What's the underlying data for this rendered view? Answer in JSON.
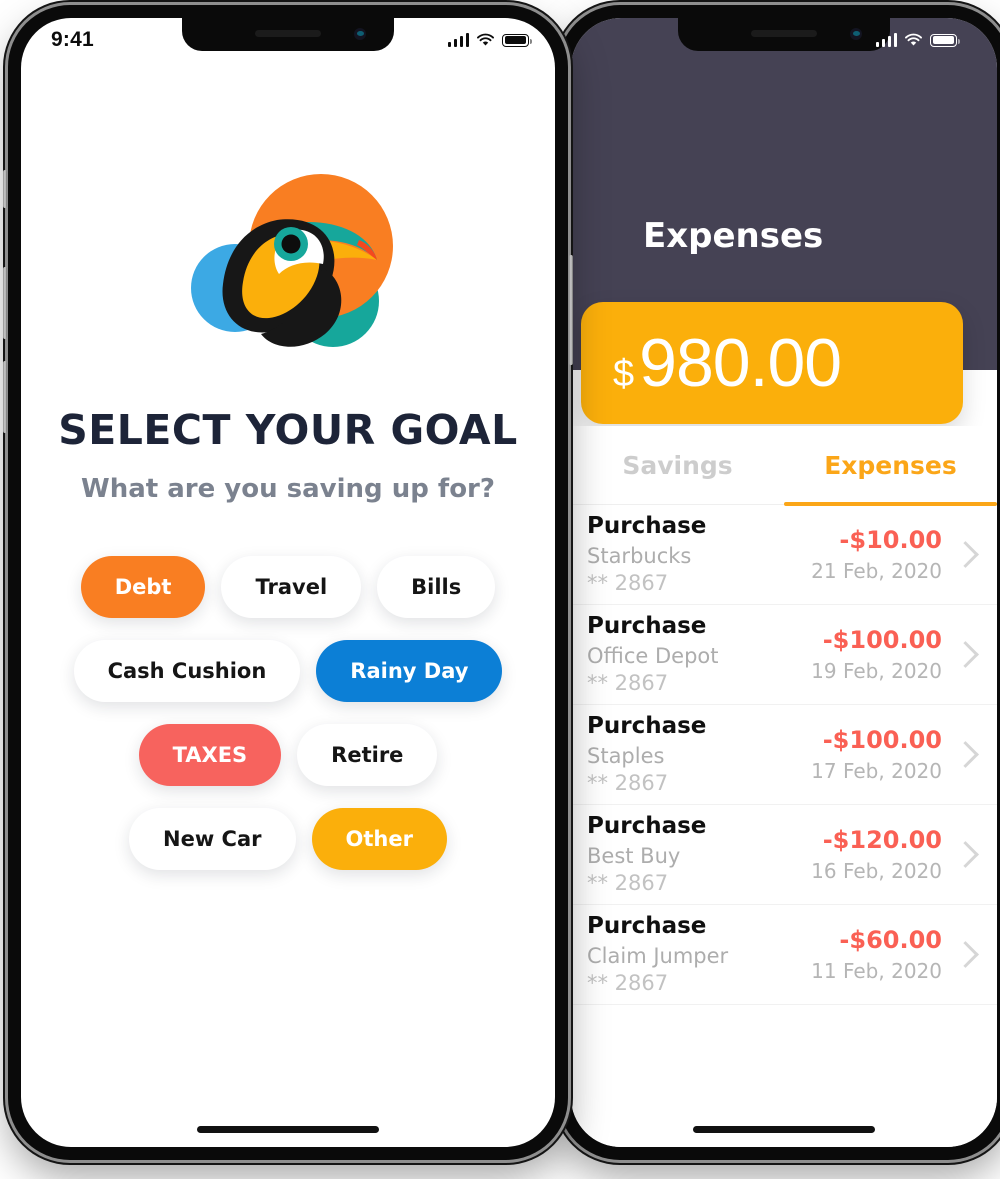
{
  "colors": {
    "orange": "#F97E22",
    "blue": "#0C7FD6",
    "red": "#F7635E",
    "amber": "#FBAF0B",
    "teal": "#16A79B",
    "sky": "#3CA9E4",
    "navy": "#1D2438",
    "slate": "#454254",
    "expense_red": "#FA6054",
    "tab_active": "#FBA618"
  },
  "phone1": {
    "status": {
      "time": "9:41",
      "cellular_icon": "signal-bars-icon",
      "wifi_icon": "wifi-icon",
      "battery_icon": "battery-icon"
    },
    "logo": {
      "name": "toucan-logo"
    },
    "title": "SELECT YOUR GOAL",
    "subtitle": "What are you saving up for?",
    "chip_rows": [
      [
        {
          "label": "Debt",
          "selected": true,
          "color": "#F97E22"
        },
        {
          "label": "Travel",
          "selected": false,
          "color": "#FFFFFF"
        },
        {
          "label": "Bills",
          "selected": false,
          "color": "#FFFFFF"
        }
      ],
      [
        {
          "label": "Cash Cushion",
          "selected": false,
          "color": "#FFFFFF"
        },
        {
          "label": "Rainy Day",
          "selected": true,
          "color": "#0C7FD6"
        }
      ],
      [
        {
          "label": "TAXES",
          "selected": true,
          "color": "#F7635E"
        },
        {
          "label": "Retire",
          "selected": false,
          "color": "#FFFFFF"
        }
      ],
      [
        {
          "label": "New Car",
          "selected": false,
          "color": "#FFFFFF"
        },
        {
          "label": "Other",
          "selected": true,
          "color": "#FBAF0B"
        }
      ]
    ]
  },
  "phone2": {
    "status": {
      "cellular_icon": "signal-bars-icon",
      "wifi_icon": "wifi-icon",
      "battery_icon": "battery-icon"
    },
    "header_title": "Expenses",
    "balance": {
      "currency": "$",
      "value": "980.00"
    },
    "tabs": [
      {
        "label": "Savings",
        "active": false
      },
      {
        "label": "Expenses",
        "active": true
      }
    ],
    "transactions": [
      {
        "kind": "Purchase",
        "merchant": "Starbucks",
        "card": "** 2867",
        "amount": "-$10.00",
        "date": "21 Feb, 2020"
      },
      {
        "kind": "Purchase",
        "merchant": "Office Depot",
        "card": "** 2867",
        "amount": "-$100.00",
        "date": "19 Feb, 2020"
      },
      {
        "kind": "Purchase",
        "merchant": "Staples",
        "card": "** 2867",
        "amount": "-$100.00",
        "date": "17 Feb, 2020"
      },
      {
        "kind": "Purchase",
        "merchant": "Best Buy",
        "card": "** 2867",
        "amount": "-$120.00",
        "date": "16 Feb, 2020"
      },
      {
        "kind": "Purchase",
        "merchant": "Claim Jumper",
        "card": "** 2867",
        "amount": "-$60.00",
        "date": "11 Feb, 2020"
      }
    ],
    "row_chevron_icon": "chevron-right-icon"
  }
}
